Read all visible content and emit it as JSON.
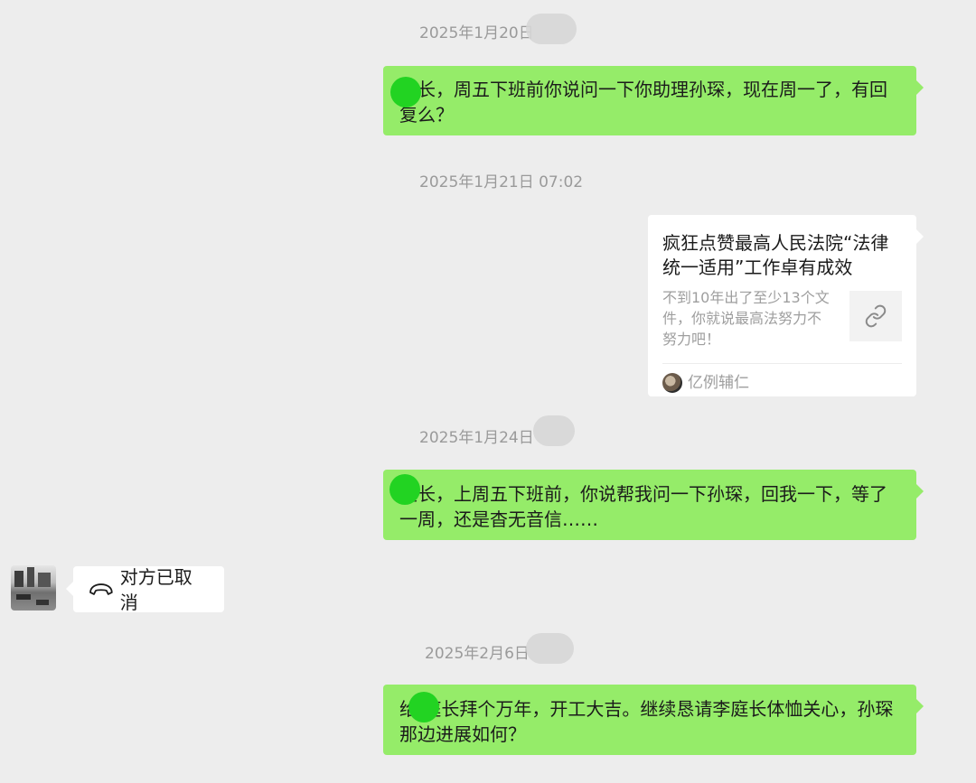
{
  "timestamps": [
    "2025年1月20日",
    "2025年1月21日 07:02",
    "2025年1月24日",
    "2025年2月6日"
  ],
  "messages": {
    "m1": "庭长，周五下班前你说问一下你助理孙琛，现在周一了，有回复么？",
    "m2": "庭长，上周五下班前，你说帮我问一下孙琛，回我一下，等了一周，还是杳无音信……",
    "m3": "给 庭长拜个万年，开工大吉。继续恳请李庭长体恤关心，孙琛那边进展如何？"
  },
  "link_card": {
    "title": "疯狂点赞最高人民法院“法律统一适用”工作卓有成效",
    "description": "不到10年出了至少13个文件，你就说最高法努力不努力吧！",
    "source": "亿例辅仁",
    "icon": "link-icon"
  },
  "call": {
    "status": "对方已取消",
    "icon": "phone-hangup-icon"
  },
  "colors": {
    "background": "#ededed",
    "self_bubble": "#95ec69",
    "other_bubble": "#ffffff",
    "redaction_dot": "#22d322"
  }
}
